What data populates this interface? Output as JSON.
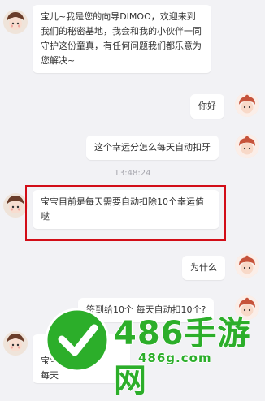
{
  "messages": [
    {
      "side": "left",
      "avatar": "dimoo-avatar",
      "text": "宝儿~我是您的向导DIMOO，欢迎来到我们的秘密基地，我会和我的小伙伴一同守护这份童真，有任何问题我们都乐意为您解决~"
    },
    {
      "side": "right",
      "avatar": "user-avatar",
      "text": "你好"
    },
    {
      "side": "right",
      "avatar": "user-avatar",
      "text": "这个幸运分怎么每天自动扣牙"
    },
    {
      "side": "left",
      "avatar": "dimoo-avatar",
      "text": "宝宝目前是每天需要自动扣除10个幸运值哒"
    },
    {
      "side": "right",
      "avatar": "user-avatar",
      "text": "为什么"
    },
    {
      "side": "right",
      "avatar": "user-avatar",
      "text": "签到给10个  每天自动扣10个?"
    },
    {
      "side": "left",
      "avatar": "dimoo-avatar",
      "text": "宝宝\n每天"
    }
  ],
  "timestamp": "13:48:24",
  "watermark": {
    "brand": "486手游网",
    "domain": "486g.com"
  },
  "colors": {
    "highlight": "#d20d17",
    "background": "#f2f2f5",
    "watermark": "#2cae2a"
  }
}
